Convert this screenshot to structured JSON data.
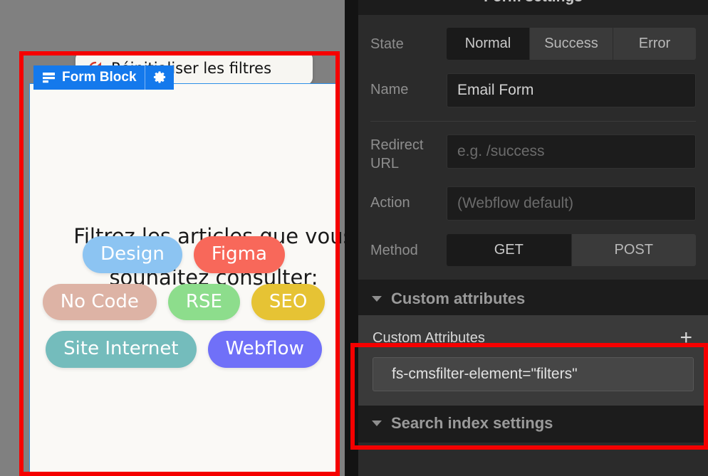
{
  "canvas": {
    "reset_button": {
      "label": "Réinitialiser les filtres",
      "icon": "refresh-reset-icon",
      "icon_color": "#d33a2c",
      "background": "#f7f6f2"
    },
    "form_block": {
      "badge_label": "Form Block",
      "badge_icon": "form-lines-icon",
      "badge_gear_icon": "gear-icon",
      "badge_color": "#1479ec",
      "selection_border_color": "#2b8fe8",
      "heading": "Filtrez les articles que vous souhaitez consulter:",
      "pills": [
        {
          "label": "Design",
          "color": "#8cc4f2"
        },
        {
          "label": "Figma",
          "color": "#f8685a"
        },
        {
          "label": "No Code",
          "color": "#ddb3a5"
        },
        {
          "label": "RSE",
          "color": "#8ddd8c"
        },
        {
          "label": "SEO",
          "color": "#e6c334"
        },
        {
          "label": "Site Internet",
          "color": "#74bcbc"
        },
        {
          "label": "Webflow",
          "color": "#7070f8"
        }
      ]
    }
  },
  "panel": {
    "title": "Form settings",
    "rows": {
      "state": {
        "label": "State",
        "options": [
          "Normal",
          "Success",
          "Error"
        ],
        "selected": "Normal"
      },
      "name": {
        "label": "Name",
        "value": "Email Form",
        "placeholder": ""
      },
      "redirect_url": {
        "label": "Redirect URL",
        "value": "",
        "placeholder": "e.g. /success"
      },
      "action": {
        "label": "Action",
        "value": "",
        "placeholder": "(Webflow default)"
      },
      "method": {
        "label": "Method",
        "options": [
          "GET",
          "POST"
        ],
        "selected": "GET"
      }
    },
    "custom_attributes_section": {
      "title": "Custom attributes",
      "list_label": "Custom Attributes",
      "add_icon": "plus-icon",
      "attributes": [
        {
          "value": "fs-cmsfilter-element=\"filters\""
        }
      ]
    },
    "search_index_section": {
      "title": "Search index settings"
    }
  },
  "annotations": {
    "color": "#f50000",
    "boxes": [
      {
        "name": "form-block-highlight"
      },
      {
        "name": "custom-attributes-highlight"
      }
    ]
  }
}
